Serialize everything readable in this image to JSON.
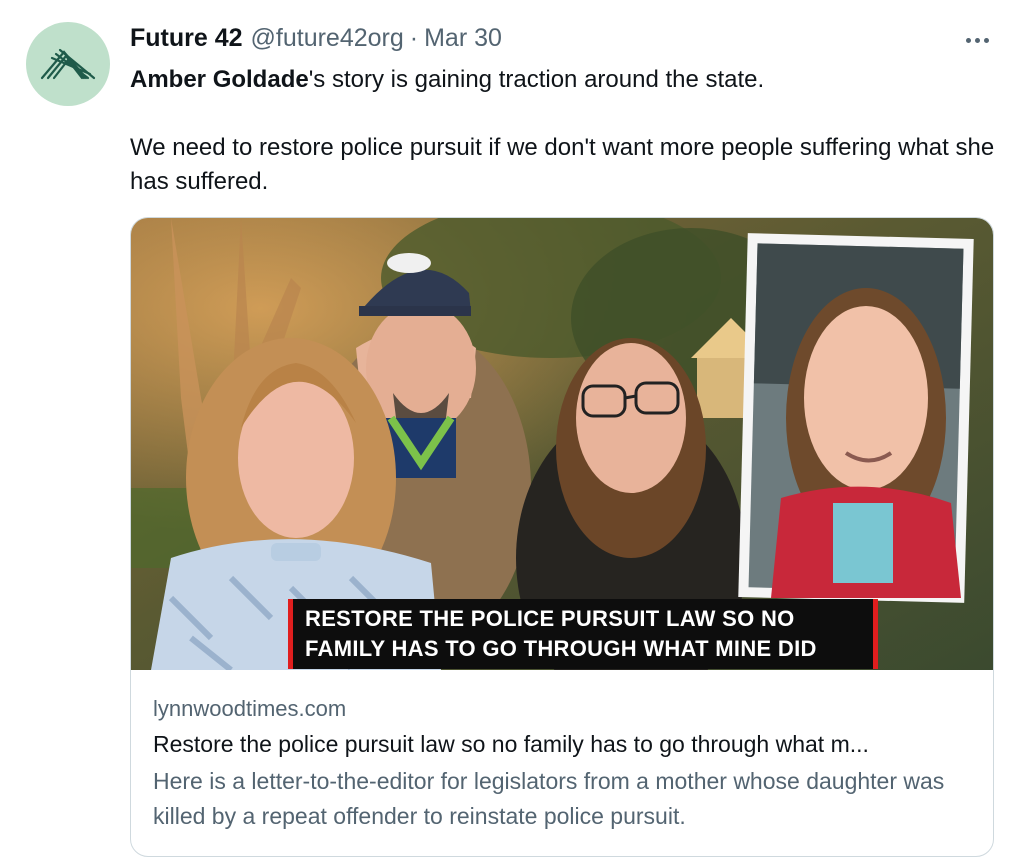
{
  "author": {
    "display_name": "Future 42",
    "handle": "@future42org",
    "separator": "·",
    "date": "Mar 30",
    "avatar_icon": "future42-mountain-logo",
    "avatar_color": "#bfe0cb"
  },
  "more_icon": "more-horizontal-icon",
  "tweet": {
    "mention": "Amber Goldade",
    "line1_rest": "'s story is gaining traction around the state.",
    "paragraph2": "We need to restore police pursuit if we don't want more people suffering what she has suffered."
  },
  "card": {
    "chyron_line1": "RESTORE THE POLICE PURSUIT LAW SO NO",
    "chyron_line2": "FAMILY HAS TO GO THROUGH WHAT MINE DID",
    "chyron_accent": "#e01e1e",
    "domain": "lynnwoodtimes.com",
    "title": "Restore the police pursuit law so no family has to go through what m...",
    "description": "Here is a letter-to-the-editor for legislators from a mother whose daughter was killed by a repeat offender to reinstate police pursuit."
  }
}
